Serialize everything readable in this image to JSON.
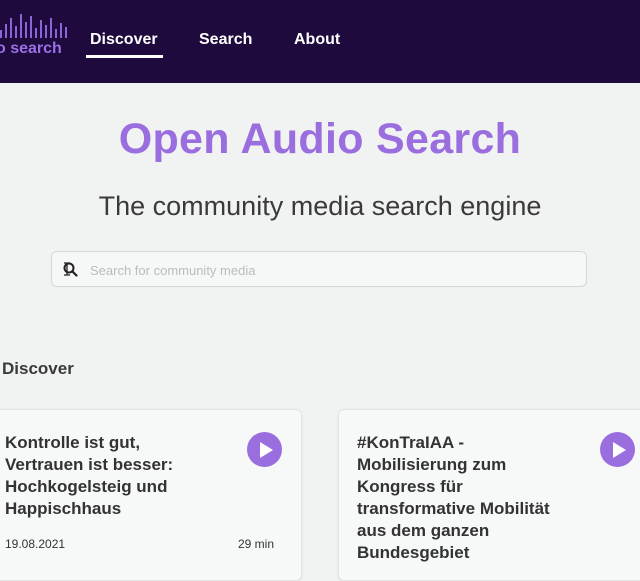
{
  "brand": {
    "logo_text": "o search"
  },
  "nav": {
    "discover": "Discover",
    "search": "Search",
    "about": "About"
  },
  "hero": {
    "title": "Open Audio Search",
    "subtitle": "The community media search engine"
  },
  "search": {
    "placeholder": "Search for community media",
    "value": ""
  },
  "discover": {
    "heading": "Discover",
    "cards": [
      {
        "title": "Kontrolle ist gut, Vertrauen ist besser: Hochkogelsteig und Happischhaus",
        "date": "19.08.2021",
        "duration": "29 min"
      },
      {
        "title": "#KonTraIAA - Mobilisierung zum Kongress für transformative Mobilität aus dem ganzen Bundesgebiet"
      }
    ]
  },
  "colors": {
    "nav_bg": "#1e0a3c",
    "accent": "#9a6ede",
    "background": "#f1f2f2"
  },
  "icons": {
    "search": "search-icon",
    "play": "play-icon",
    "logo": "audio-waveform-icon"
  }
}
